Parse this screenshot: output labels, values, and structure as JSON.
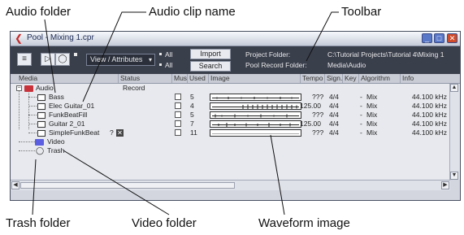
{
  "callouts": {
    "audio_folder": "Audio folder",
    "audio_clip_name": "Audio clip name",
    "toolbar": "Toolbar",
    "trash_folder": "Trash folder",
    "video_folder": "Video folder",
    "waveform_image": "Waveform image"
  },
  "window": {
    "title": "Pool - Mixing 1.cpr"
  },
  "toolbar": {
    "view_select": "View / Attributes",
    "all_1": "All",
    "all_2": "All",
    "import_button": "Import",
    "search_button": "Search",
    "project_folder_label": "Project Folder:",
    "project_folder_value": "C:\\Tutorial Projects\\Tutorial 4\\Mixing 1",
    "record_folder_label": "Pool Record Folder:",
    "record_folder_value": "Media\\Audio"
  },
  "columns": {
    "media": "Media",
    "status": "Status",
    "mus": "Mus",
    "used": "Used",
    "image": "Image",
    "tempo": "Tempo",
    "sign": "Sign.",
    "key": "Key",
    "algorithm": "Algorithm",
    "info": "Info"
  },
  "folders": {
    "audio": {
      "name": "Audio",
      "status": "Record"
    },
    "video": {
      "name": "Video"
    },
    "trash": {
      "name": "Trash"
    }
  },
  "clips": [
    {
      "name": "Bass",
      "used": "5",
      "tempo": "???",
      "sign": "4/4",
      "key": "-",
      "algorithm": "Mix",
      "info": "44.100 kHz"
    },
    {
      "name": "Elec Guitar_01",
      "used": "4",
      "tempo": "125.00",
      "sign": "4/4",
      "key": "-",
      "algorithm": "Mix",
      "info": "44.100 kHz"
    },
    {
      "name": "FunkBeatFill",
      "used": "5",
      "tempo": "???",
      "sign": "4/4",
      "key": "-",
      "algorithm": "Mix",
      "info": "44.100 kHz"
    },
    {
      "name": "Guitar 2_01",
      "used": "7",
      "tempo": "125.00",
      "sign": "4/4",
      "key": "-",
      "algorithm": "Mix",
      "info": "44.100 kHz"
    },
    {
      "name": "SimpleFunkBeat",
      "status": "?",
      "used": "11",
      "tempo": "???",
      "sign": "4/4",
      "key": "-",
      "algorithm": "Mix",
      "info": "44.100 kHz"
    }
  ]
}
